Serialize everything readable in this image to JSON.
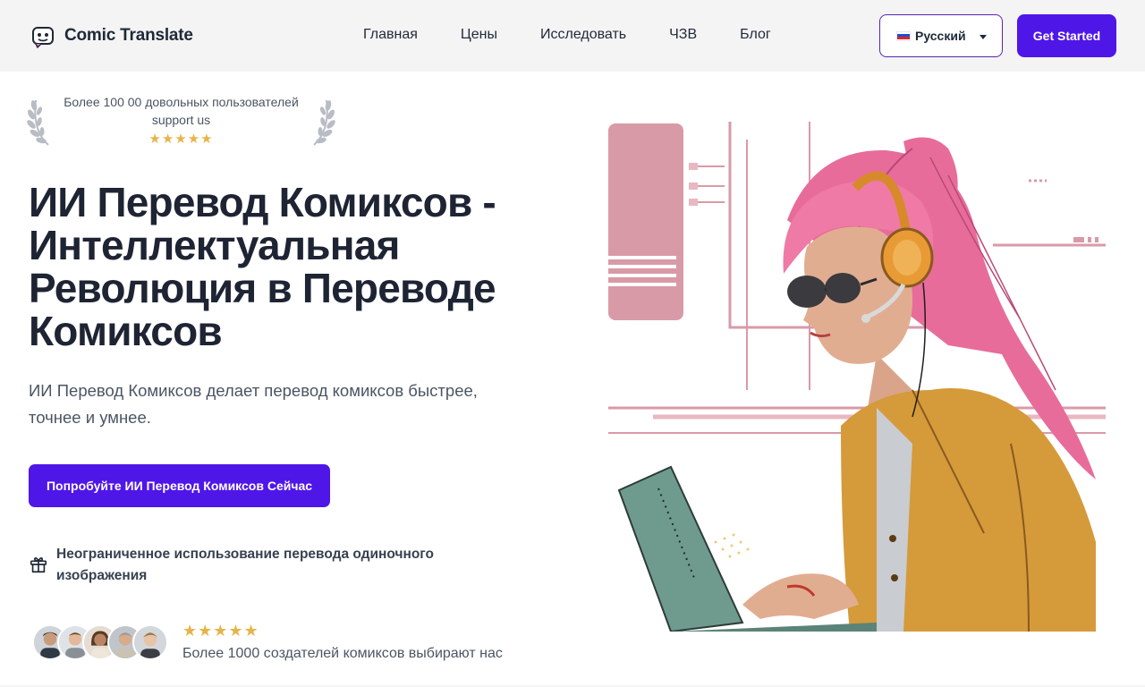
{
  "header": {
    "brand_name": "Comic Translate",
    "nav": [
      "Главная",
      "Цены",
      "Исследовать",
      "ЧЗВ",
      "Блог"
    ],
    "language_label": "Русский",
    "get_started_label": "Get Started"
  },
  "award": {
    "text_line1": "Более 100 00 довольных пользователей",
    "text_line2": "support us",
    "rating_stars": "★★★★★",
    "rating": 5
  },
  "hero": {
    "headline": "ИИ Перевод Комиксов - Интеллектуальная Революция в Переводе Комиксов",
    "subtext": "ИИ Перевод Комиксов делает перевод комиксов быстрее, точнее и умнее.",
    "cta_label": "Попробуйте ИИ Перевод Комиксов Сейчас",
    "feature_text": "Неограниченное использование перевода одиночного изображения"
  },
  "social_proof": {
    "rating_stars": "★★★★★",
    "rating": 5,
    "text": "Более 1000 создателей комиксов выбирают нас",
    "avatars": [
      "avatar-1",
      "avatar-2",
      "avatar-3",
      "avatar-4",
      "avatar-5"
    ]
  },
  "colors": {
    "accent": "#4f16e8",
    "header_bg": "#f4f4f5",
    "star": "#e6b44a",
    "heading": "#1e2433"
  },
  "icons": [
    "robot-logo-icon",
    "russia-flag-icon",
    "chevron-down-icon",
    "laurel-left-icon",
    "laurel-right-icon",
    "gift-icon"
  ]
}
